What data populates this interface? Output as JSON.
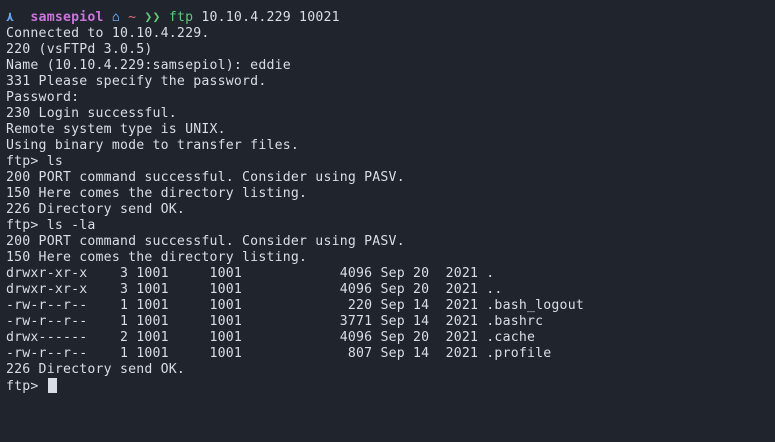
{
  "prompt": {
    "arrow_icon": "▲-icon",
    "arrow_glyph": "⋏",
    "user": "samsepiol",
    "home_glyph": "⌂",
    "tilde": "~",
    "chevrons": "❯❯",
    "command": "ftp",
    "args": "10.10.4.229 10021"
  },
  "lines": [
    "Connected to 10.10.4.229.",
    "220 (vsFTPd 3.0.5)",
    "Name (10.10.4.229:samsepiol): eddie",
    "331 Please specify the password.",
    "Password:",
    "230 Login successful.",
    "Remote system type is UNIX.",
    "Using binary mode to transfer files.",
    "ftp> ls",
    "200 PORT command successful. Consider using PASV.",
    "150 Here comes the directory listing.",
    "226 Directory send OK.",
    "ftp> ls -la",
    "200 PORT command successful. Consider using PASV.",
    "150 Here comes the directory listing."
  ],
  "listing": [
    {
      "perm": "drwxr-xr-x",
      "links": "3",
      "owner": "1001",
      "group": "1001",
      "size": "4096",
      "month": "Sep",
      "day": "20",
      "year": "2021",
      "name": "."
    },
    {
      "perm": "drwxr-xr-x",
      "links": "3",
      "owner": "1001",
      "group": "1001",
      "size": "4096",
      "month": "Sep",
      "day": "20",
      "year": "2021",
      "name": ".."
    },
    {
      "perm": "-rw-r--r--",
      "links": "1",
      "owner": "1001",
      "group": "1001",
      "size": "220",
      "month": "Sep",
      "day": "14",
      "year": "2021",
      "name": ".bash_logout"
    },
    {
      "perm": "-rw-r--r--",
      "links": "1",
      "owner": "1001",
      "group": "1001",
      "size": "3771",
      "month": "Sep",
      "day": "14",
      "year": "2021",
      "name": ".bashrc"
    },
    {
      "perm": "drwx------",
      "links": "2",
      "owner": "1001",
      "group": "1001",
      "size": "4096",
      "month": "Sep",
      "day": "20",
      "year": "2021",
      "name": ".cache"
    },
    {
      "perm": "-rw-r--r--",
      "links": "1",
      "owner": "1001",
      "group": "1001",
      "size": "807",
      "month": "Sep",
      "day": "14",
      "year": "2021",
      "name": ".profile"
    }
  ],
  "after_listing": "226 Directory send OK.",
  "final_prompt": "ftp> ",
  "colors": {
    "background": "#20242c",
    "text": "#d9dde6",
    "user": "#c975d9",
    "accent_blue": "#6aa7f0",
    "tilde_red": "#e06c75",
    "command_green": "#63c77a"
  }
}
